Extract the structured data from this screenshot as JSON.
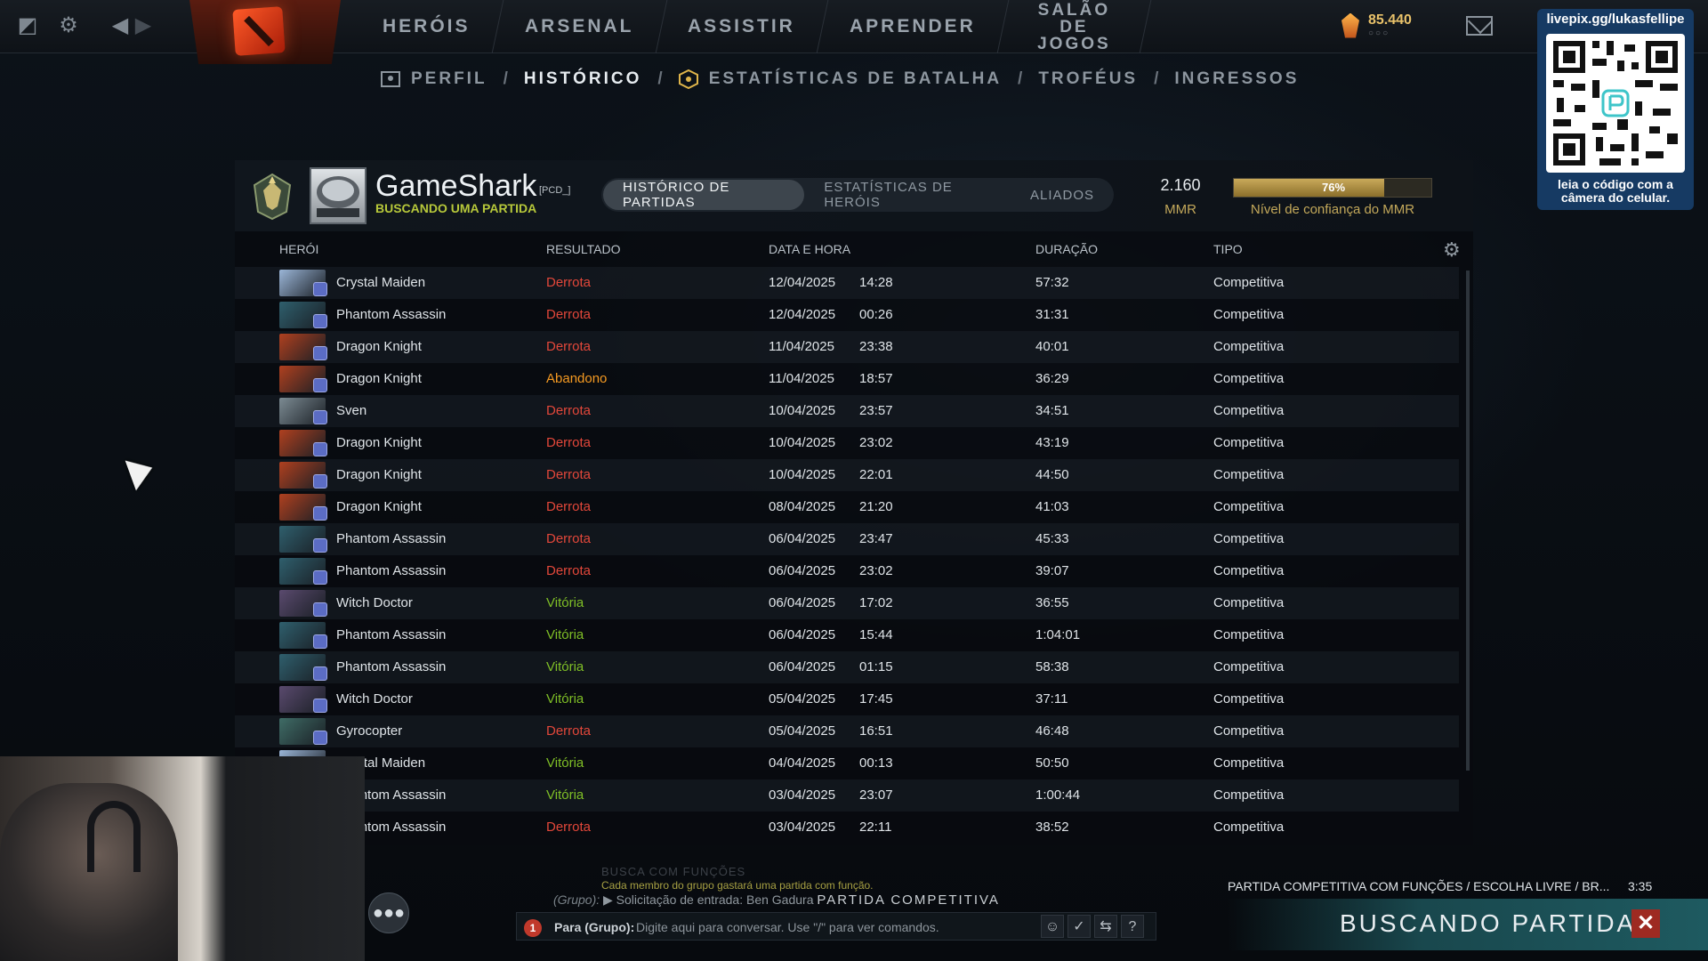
{
  "topbar": {
    "nav": [
      "HERÓIS",
      "ARSENAL",
      "ASSISTIR",
      "APRENDER",
      "SALÃO DE JOGOS"
    ],
    "shards": "85.440",
    "shard_dots": "○○○"
  },
  "subnav": {
    "items": [
      "PERFIL",
      "HISTÓRICO",
      "ESTATÍSTICAS DE BATALHA",
      "TROFÉUS",
      "INGRESSOS"
    ],
    "separator": "/"
  },
  "qr": {
    "title": "livepix.gg/lukasfellipe",
    "caption": "leia o código com a câmera do celular."
  },
  "profile": {
    "name": "GameShark",
    "tag": "[PCD_]",
    "status": "BUSCANDO UMA PARTIDA",
    "tabs": [
      "HISTÓRICO DE PARTIDAS",
      "ESTATÍSTICAS DE HERÓIS",
      "ALIADOS"
    ],
    "mmr": "2.160",
    "mmr_label": "MMR",
    "confidence": 0.76,
    "confidence_text": "76%",
    "confidence_label": "Nível de confiança do MMR"
  },
  "table": {
    "headers": [
      "HERÓI",
      "RESULTADO",
      "DATA E HORA",
      "DURAÇÃO",
      "TIPO"
    ],
    "rows": [
      {
        "hero": "Crystal Maiden",
        "result": "Derrota",
        "kind": "loss",
        "date": "12/04/2025",
        "time": "14:28",
        "duration": "57:32",
        "type": "Competitiva",
        "color": "#9bb6d8"
      },
      {
        "hero": "Phantom Assassin",
        "result": "Derrota",
        "kind": "loss",
        "date": "12/04/2025",
        "time": "00:26",
        "duration": "31:31",
        "type": "Competitiva",
        "color": "#2f5f6d"
      },
      {
        "hero": "Dragon Knight",
        "result": "Derrota",
        "kind": "loss",
        "date": "11/04/2025",
        "time": "23:38",
        "duration": "40:01",
        "type": "Competitiva",
        "color": "#b0401f"
      },
      {
        "hero": "Dragon Knight",
        "result": "Abandono",
        "kind": "abandon",
        "date": "11/04/2025",
        "time": "18:57",
        "duration": "36:29",
        "type": "Competitiva",
        "color": "#b0401f"
      },
      {
        "hero": "Sven",
        "result": "Derrota",
        "kind": "loss",
        "date": "10/04/2025",
        "time": "23:57",
        "duration": "34:51",
        "type": "Competitiva",
        "color": "#7c8b93"
      },
      {
        "hero": "Dragon Knight",
        "result": "Derrota",
        "kind": "loss",
        "date": "10/04/2025",
        "time": "23:02",
        "duration": "43:19",
        "type": "Competitiva",
        "color": "#b0401f"
      },
      {
        "hero": "Dragon Knight",
        "result": "Derrota",
        "kind": "loss",
        "date": "10/04/2025",
        "time": "22:01",
        "duration": "44:50",
        "type": "Competitiva",
        "color": "#b0401f"
      },
      {
        "hero": "Dragon Knight",
        "result": "Derrota",
        "kind": "loss",
        "date": "08/04/2025",
        "time": "21:20",
        "duration": "41:03",
        "type": "Competitiva",
        "color": "#b0401f"
      },
      {
        "hero": "Phantom Assassin",
        "result": "Derrota",
        "kind": "loss",
        "date": "06/04/2025",
        "time": "23:47",
        "duration": "45:33",
        "type": "Competitiva",
        "color": "#2f5f6d"
      },
      {
        "hero": "Phantom Assassin",
        "result": "Derrota",
        "kind": "loss",
        "date": "06/04/2025",
        "time": "23:02",
        "duration": "39:07",
        "type": "Competitiva",
        "color": "#2f5f6d"
      },
      {
        "hero": "Witch Doctor",
        "result": "Vitória",
        "kind": "win",
        "date": "06/04/2025",
        "time": "17:02",
        "duration": "36:55",
        "type": "Competitiva",
        "color": "#5a4a6e"
      },
      {
        "hero": "Phantom Assassin",
        "result": "Vitória",
        "kind": "win",
        "date": "06/04/2025",
        "time": "15:44",
        "duration": "1:04:01",
        "type": "Competitiva",
        "color": "#2f5f6d"
      },
      {
        "hero": "Phantom Assassin",
        "result": "Vitória",
        "kind": "win",
        "date": "06/04/2025",
        "time": "01:15",
        "duration": "58:38",
        "type": "Competitiva",
        "color": "#2f5f6d"
      },
      {
        "hero": "Witch Doctor",
        "result": "Vitória",
        "kind": "win",
        "date": "05/04/2025",
        "time": "17:45",
        "duration": "37:11",
        "type": "Competitiva",
        "color": "#5a4a6e"
      },
      {
        "hero": "Gyrocopter",
        "result": "Derrota",
        "kind": "loss",
        "date": "05/04/2025",
        "time": "16:51",
        "duration": "46:48",
        "type": "Competitiva",
        "color": "#3f6c66"
      },
      {
        "hero": "Crystal Maiden",
        "result": "Vitória",
        "kind": "win",
        "date": "04/04/2025",
        "time": "00:13",
        "duration": "50:50",
        "type": "Competitiva",
        "color": "#9bb6d8"
      },
      {
        "hero": "Phantom Assassin",
        "result": "Vitória",
        "kind": "win",
        "date": "03/04/2025",
        "time": "23:07",
        "duration": "1:00:44",
        "type": "Competitiva",
        "color": "#2f5f6d"
      },
      {
        "hero": "Phantom Assassin",
        "result": "Derrota",
        "kind": "loss",
        "date": "03/04/2025",
        "time": "22:11",
        "duration": "38:52",
        "type": "Competitiva",
        "color": "#2f5f6d"
      }
    ]
  },
  "chat": {
    "faded": "BUSCA COM FUNÇÕES",
    "info": "Cada membro do grupo gastará uma partida com função.",
    "group_prefix": "(Grupo):",
    "group_msg": "▶ Solicitação de entrada: Ben Gadura",
    "group_big": "PARTIDA COMPETITIVA",
    "alert": "1",
    "target": "Para (Grupo):",
    "placeholder": "Digite aqui para conversar. Use \"/\" para ver comandos."
  },
  "queue": {
    "info": "PARTIDA COMPETITIVA COM FUNÇÕES / ESCOLHA LIVRE / BR...",
    "time": "3:35",
    "label": "BUSCANDO PARTIDA",
    "cancel": "✕"
  }
}
